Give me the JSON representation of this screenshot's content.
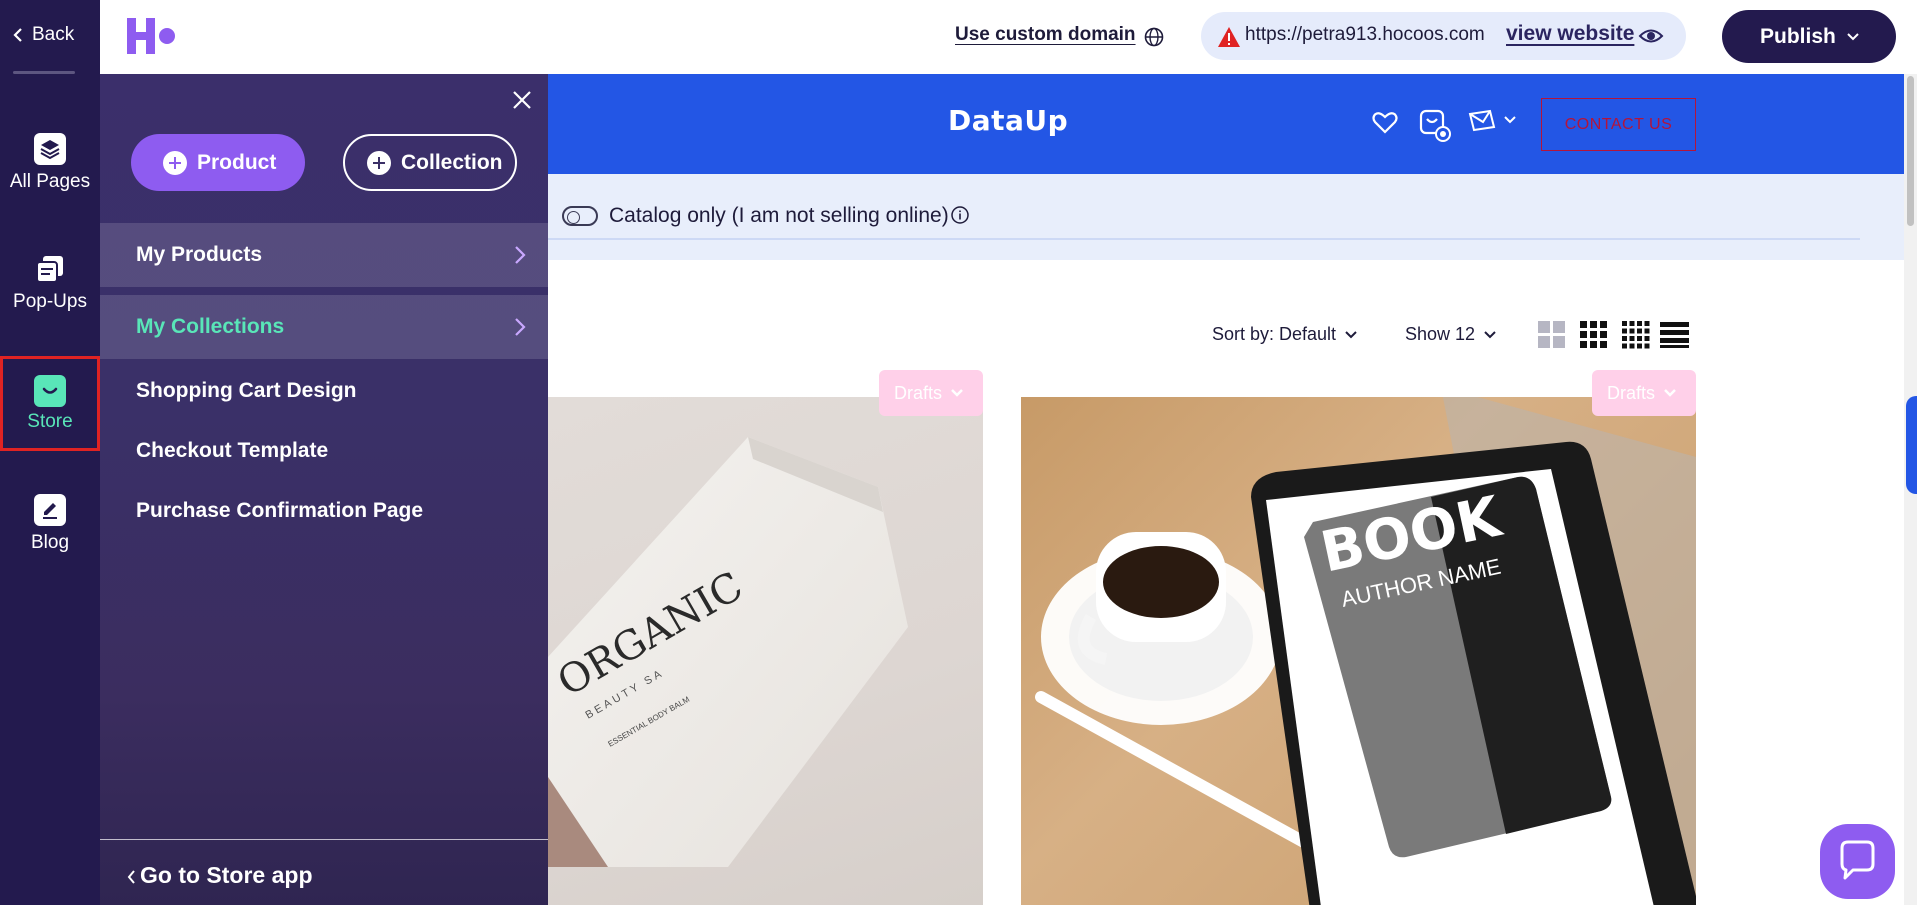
{
  "topbar": {
    "custom_domain_label": "Use custom domain",
    "url": "https://petra913.hocoos.com",
    "view_website_label": "view website",
    "publish_label": "Publish"
  },
  "rail": {
    "back_label": "Back",
    "items": [
      {
        "label": "All Pages",
        "icon": "layers-icon"
      },
      {
        "label": "Pop-Ups",
        "icon": "popups-icon"
      },
      {
        "label": "Store",
        "icon": "shopping-bag-icon",
        "active": true
      },
      {
        "label": "Blog",
        "icon": "blog-edit-icon"
      }
    ]
  },
  "panel": {
    "product_button": "Product",
    "collection_button": "Collection",
    "menu": [
      {
        "label": "My Products",
        "has_arrow": true,
        "highlighted": true
      },
      {
        "label": "My Collections",
        "has_arrow": true,
        "highlighted": true,
        "selected": true
      },
      {
        "label": "Shopping Cart Design"
      },
      {
        "label": "Checkout Template"
      },
      {
        "label": "Purchase Confirmation Page"
      }
    ],
    "go_store_label": "Go to Store app"
  },
  "site": {
    "brand": "DataUp",
    "contact_label": "CONTACT US",
    "catalog_label": "Catalog only (I am not selling online)",
    "sort_label": "Sort by: Default",
    "show_label": "Show 12",
    "cards": [
      {
        "status": "Drafts",
        "image": "organic beauty balm tube",
        "image_text": [
          "ORGANIC",
          "BEAUTY SA",
          "ESSENTIAL BODY BALM"
        ]
      },
      {
        "status": "Drafts",
        "image": "tablet with book cover and coffee cup",
        "image_text": [
          "BOOK",
          "AUTHOR NAME"
        ]
      }
    ]
  },
  "colors": {
    "rail_bg": "#231a4e",
    "panel_bg": "#3a3068",
    "accent_purple": "#8e5cf0",
    "accent_teal": "#59e6b8",
    "site_blue": "#2356e5",
    "contact_red": "#b4143b",
    "drafts_pink": "#ffd0e9"
  }
}
